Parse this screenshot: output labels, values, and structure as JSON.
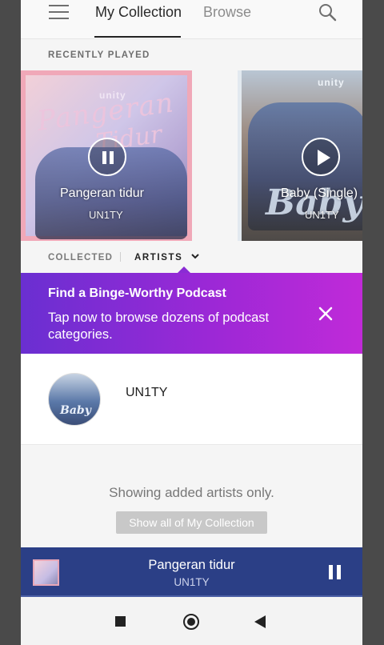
{
  "header": {
    "tabs": [
      {
        "label": "My Collection",
        "active": true
      },
      {
        "label": "Browse",
        "active": false
      }
    ],
    "menu_icon": "hamburger-menu-icon",
    "search_icon": "search-icon"
  },
  "recently_played": {
    "label": "RECENTLY PLAYED",
    "items": [
      {
        "title": "Pangeran tidur",
        "artist": "UN1TY",
        "state": "playing",
        "logo": "unity",
        "art_text_1": "Pangeran",
        "art_text_2": "Tidur"
      },
      {
        "title": "Baby (Single)",
        "artist": "UN1TY",
        "state": "paused",
        "logo": "unity",
        "art_text": "Baby"
      }
    ]
  },
  "filter": {
    "collected_label": "COLLECTED",
    "artists_label": "ARTISTS"
  },
  "promo": {
    "title": "Find a Binge-Worthy Podcast",
    "body": "Tap now to browse dozens of podcast categories.",
    "colors": {
      "start": "#6a2fd1",
      "end": "#c02ad8"
    }
  },
  "artists": [
    {
      "name": "UN1TY",
      "avatar_text": "Baby"
    }
  ],
  "empty_note": "Showing added artists only.",
  "show_all_label": "Show all of My Collection",
  "player": {
    "title": "Pangeran tidur",
    "artist": "UN1TY",
    "state": "playing",
    "color": "#2b3f86"
  }
}
